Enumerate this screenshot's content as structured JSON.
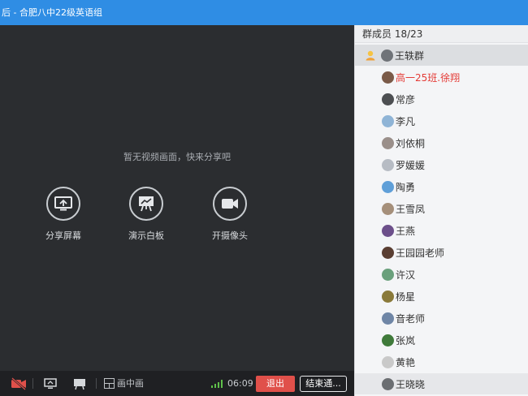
{
  "window": {
    "title": "后 - 合肥八中22级英语组"
  },
  "main": {
    "empty_hint": "暂无视频画面，快来分享吧",
    "actions": [
      {
        "label": "分享屏幕",
        "icon": "share-screen-icon"
      },
      {
        "label": "演示白板",
        "icon": "whiteboard-icon"
      },
      {
        "label": "开摄像头",
        "icon": "camera-icon"
      }
    ]
  },
  "toolbar": {
    "mic_icon": "camera-off-icon",
    "layout_label": "画中画",
    "signal_icon": "signal-bars-icon",
    "time": "06:09",
    "exit_label": "退出",
    "end_label": "结束通..."
  },
  "sidebar": {
    "header": "群成员 18/23",
    "members": [
      {
        "name": "王轶群",
        "host": true,
        "selected": true
      },
      {
        "name": "高一25班.徐翔",
        "highlight": true
      },
      {
        "name": "常彦"
      },
      {
        "name": "李凡"
      },
      {
        "name": "刘依桐"
      },
      {
        "name": "罗媛媛"
      },
      {
        "name": "陶勇"
      },
      {
        "name": "王雪凤"
      },
      {
        "name": "王燕"
      },
      {
        "name": "王园园老师"
      },
      {
        "name": "许汉"
      },
      {
        "name": "杨星"
      },
      {
        "name": "音老师"
      },
      {
        "name": "张岚"
      },
      {
        "name": "黄艳"
      },
      {
        "name": "王晓晓"
      }
    ]
  },
  "colors": {
    "titlebar": "#2f8de4",
    "exit_button": "#e0504a",
    "highlight_name": "#e43b36",
    "signal": "#5fc04a"
  }
}
